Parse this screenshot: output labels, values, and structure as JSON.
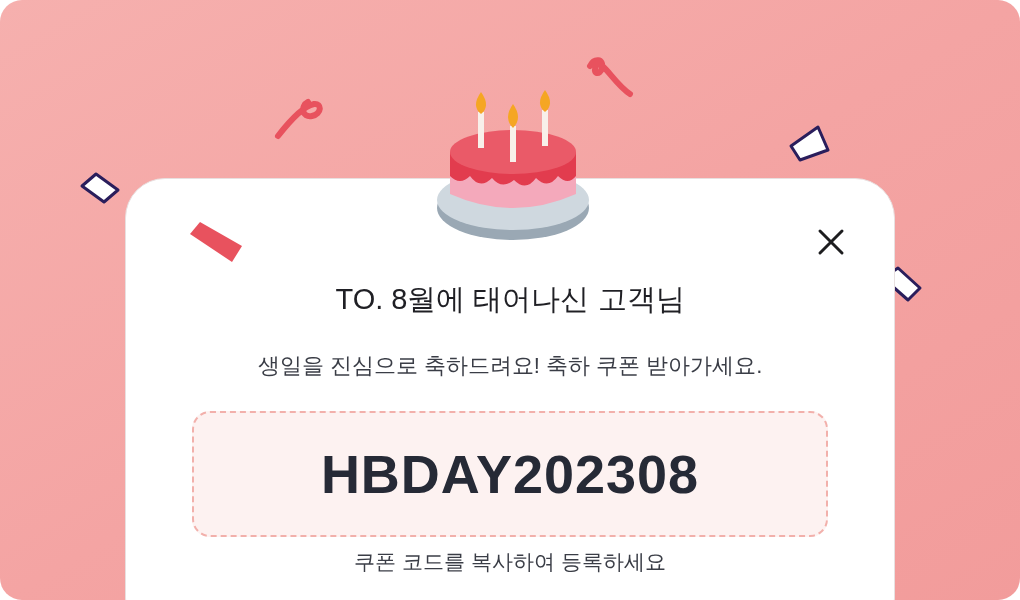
{
  "dialog": {
    "title": "TO. 8월에 태어나신 고객님",
    "message": "생일을 진심으로 축하드려요! 축하 쿠폰 받아가세요.",
    "coupon": {
      "code": "HBDAY202308",
      "hint": "쿠폰 코드를 복사하여 등록하세요"
    }
  }
}
